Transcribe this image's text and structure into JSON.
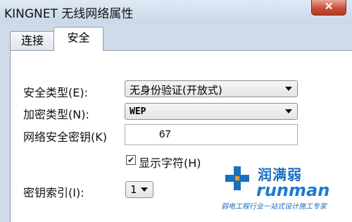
{
  "window": {
    "title": "KINGNET 无线网络属性",
    "close_glyph": "✕"
  },
  "tabs": [
    {
      "label": "连接"
    },
    {
      "label": "安全"
    }
  ],
  "security": {
    "type_label": "安全类型(E):",
    "type_value": "无身份验证(开放式)",
    "encryption_label": "加密类型(N):",
    "encryption_value": "WEP",
    "key_label": "网络安全密钥(K)",
    "key_value": "67",
    "show_chars_label": "显示字符(H)",
    "show_chars_checked": true,
    "key_index_label": "密钥索引(I):",
    "key_index_value": "1"
  },
  "watermark": {
    "brand_cn": "润满弱",
    "brand_en": "runman",
    "slogan": "弱电工程行业一站式设计施工专家"
  }
}
